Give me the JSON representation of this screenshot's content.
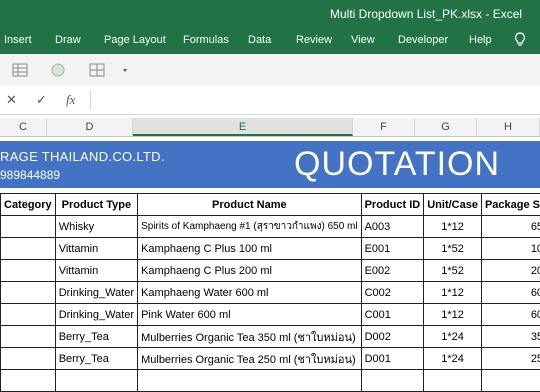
{
  "window": {
    "title": "Multi Dropdown List_PK.xlsx  -  Excel"
  },
  "ribbon": {
    "tabs": [
      "Insert",
      "Draw",
      "Page Layout",
      "Formulas",
      "Data",
      "Review",
      "View",
      "Developer",
      "Help"
    ]
  },
  "formula_bar": {
    "fx_label": "fx",
    "value": ""
  },
  "columns": [
    "C",
    "D",
    "E",
    "F",
    "G",
    "H"
  ],
  "sheet": {
    "company": "RAGE THAILAND.CO.LTD.",
    "phone": "989844889",
    "doc_title": "QUOTATION",
    "headers": [
      "Category",
      "Product Type",
      "Product Name",
      "Product ID",
      "Unit/Case",
      "Package Si"
    ],
    "rows": [
      [
        "",
        "Whisky",
        "Spirits of Kamphaeng #1 (สุราขาวกำแพง) 650 ml",
        "A003",
        "1*12",
        "65"
      ],
      [
        "",
        "Vittamin",
        "Kamphaeng C Plus 100 ml",
        "E001",
        "1*52",
        "10"
      ],
      [
        "",
        "Vittamin",
        "Kamphaeng C Plus 200 ml",
        "E002",
        "1*52",
        "20"
      ],
      [
        "",
        "Drinking_Water",
        "Kamphaeng Water 600 ml",
        "C002",
        "1*12",
        "60"
      ],
      [
        "",
        "Drinking_Water",
        "Pink Water 600 ml",
        "C001",
        "1*12",
        "60"
      ],
      [
        "",
        "Berry_Tea",
        "Mulberries Organic Tea 350 ml (ชาใบหม่อน)",
        "D002",
        "1*24",
        "35"
      ],
      [
        "",
        "Berry_Tea",
        "Mulberries Organic Tea 250 ml (ชาใบหม่อน)",
        "D001",
        "1*24",
        "25"
      ],
      [
        "",
        "",
        "",
        "",
        "",
        ""
      ]
    ]
  },
  "colors": {
    "excel_green": "#217346",
    "banner_blue": "#4472c4"
  }
}
